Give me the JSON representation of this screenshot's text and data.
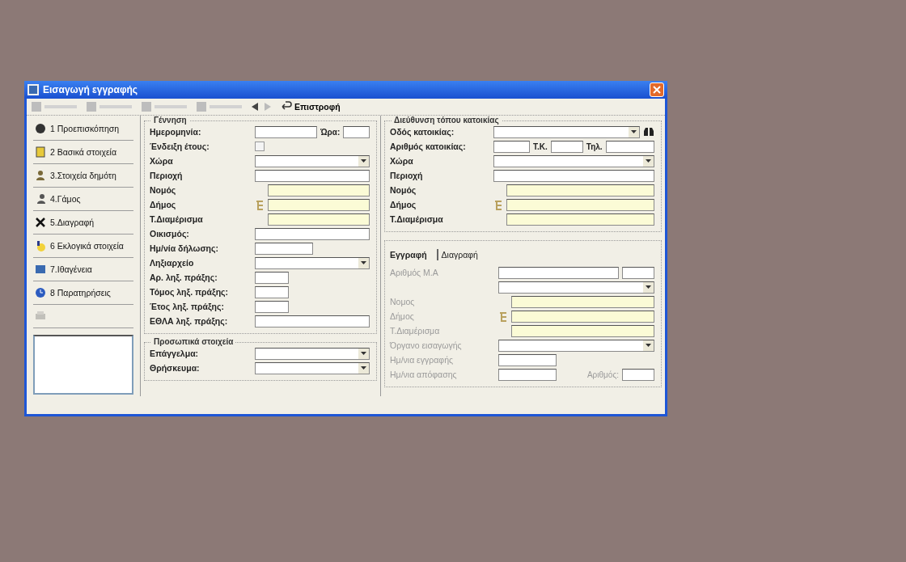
{
  "window": {
    "title": "Εισαγωγή εγγραφής"
  },
  "toolbar": {
    "return_button": "Επιστροφή"
  },
  "sidebar": {
    "items": [
      {
        "label": "1 Προεπισκόπηση",
        "disabled": false
      },
      {
        "label": "2 Βασικά στοιχεία",
        "disabled": false
      },
      {
        "label": "3.Στοιχεία δημότη",
        "disabled": false
      },
      {
        "label": "4.Γάμος",
        "disabled": false
      },
      {
        "label": "5.Διαγραφή",
        "disabled": false
      },
      {
        "label": "6 Εκλογικά στοιχεία",
        "disabled": false
      },
      {
        "label": "7.Ιθαγένεια",
        "disabled": false
      },
      {
        "label": "8 Παρατηρήσεις",
        "disabled": false
      },
      {
        "disabled": true
      }
    ]
  },
  "birth_group": {
    "title": "Γέννηση",
    "rows": [
      {
        "label": "Ημερομηνία:",
        "kind": "datetime",
        "extra_label": "Ώρα:"
      },
      {
        "label": "Ένδειξη έτους:",
        "kind": "checkbox",
        "checked": false
      },
      {
        "label": "Χώρα",
        "kind": "combo"
      },
      {
        "label": "Περιοχή",
        "kind": "text"
      },
      {
        "label": "Νομός",
        "kind": "lookup"
      },
      {
        "label": "Δήμος",
        "kind": "picker"
      },
      {
        "label": "Τ.Διαμέρισμα",
        "kind": "lookup"
      },
      {
        "label": "Οικισμός:",
        "kind": "text"
      },
      {
        "label": "Ημ/νία δήλωσης:",
        "kind": "medium"
      },
      {
        "label": "Ληξιαρχείο",
        "kind": "combo"
      },
      {
        "label": "Αρ. ληξ. πράξης:",
        "kind": "short"
      },
      {
        "label": "Τόμος ληξ. πράξης:",
        "kind": "short"
      },
      {
        "label": "Έτος ληξ. πράξης:",
        "kind": "short"
      },
      {
        "label": "ΕΘΛΑ ληξ. πράξης:",
        "kind": "text"
      }
    ]
  },
  "personal_group": {
    "title": "Προσωπικά στοιχεία",
    "rows": [
      {
        "label": "Επάγγελμα:",
        "kind": "combo"
      },
      {
        "label": "Θρήσκευμα:",
        "kind": "combo"
      }
    ]
  },
  "address_group": {
    "title": "Διεύθυνση τόπου κατοικίας",
    "rows": [
      {
        "label": "Οδός κατοικίας:",
        "kind": "search-combo"
      },
      {
        "label": "Αριθμός κατοικίας:",
        "kind": "split",
        "parts": [
          "Τ.Κ.",
          "Τηλ."
        ]
      },
      {
        "label": "Χώρα",
        "kind": "combo"
      },
      {
        "label": "Περιοχή",
        "kind": "text"
      },
      {
        "label": "Νομός",
        "kind": "lookup"
      },
      {
        "label": "Δήμος",
        "kind": "picker"
      },
      {
        "label": "Τ.Διαμέρισμα",
        "kind": "lookup"
      }
    ]
  },
  "registry_group": {
    "tabs": [
      {
        "label": "Εγγραφή",
        "selected": true
      },
      {
        "label": "Διαγραφή",
        "selected": false
      }
    ],
    "disabled": true,
    "rows": [
      {
        "label": "Αριθμός Μ.Α",
        "kind": "pair"
      },
      {
        "kind": "combo"
      },
      {
        "label": "Νομος",
        "kind": "lookup"
      },
      {
        "label": "Δήμος",
        "kind": "picker"
      },
      {
        "label": "Τ.Διαμέρισμα",
        "kind": "lookup"
      },
      {
        "label": "Όργανο εισαγωγής",
        "kind": "combo"
      },
      {
        "label": "Ημ/νια εγγραφής",
        "kind": "medium"
      },
      {
        "label": "Ημ/νια απόφασης",
        "kind": "medium",
        "extra_label": "Αριθμός:"
      }
    ]
  }
}
